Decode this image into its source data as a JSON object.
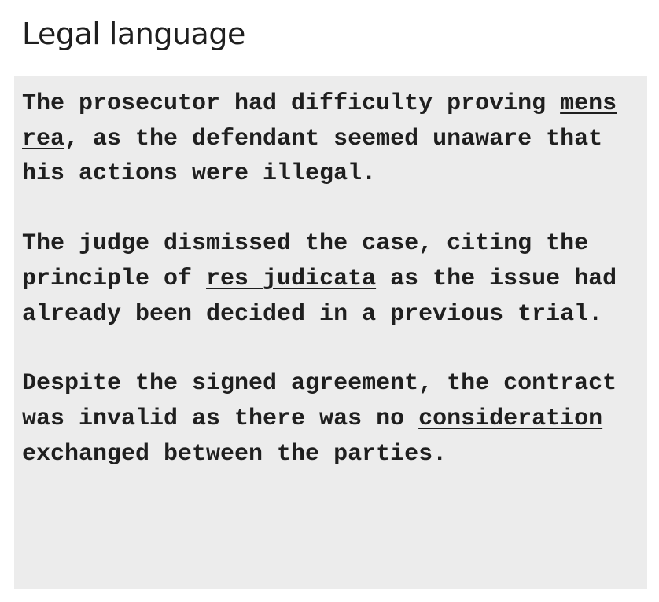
{
  "title": "Legal language",
  "paragraphs": [
    {
      "before": "The prosecutor had difficulty proving ",
      "term": "mens rea",
      "after": ", as the defendant seemed unaware that his actions were illegal."
    },
    {
      "before": "The judge dismissed the case, citing the principle of ",
      "term": "res judicata",
      "after": " as the issue had already been decided in a previous trial."
    },
    {
      "before": "Despite the signed agreement, the contract was invalid as there was no ",
      "term": "consideration",
      "after": " exchanged between the parties."
    }
  ]
}
